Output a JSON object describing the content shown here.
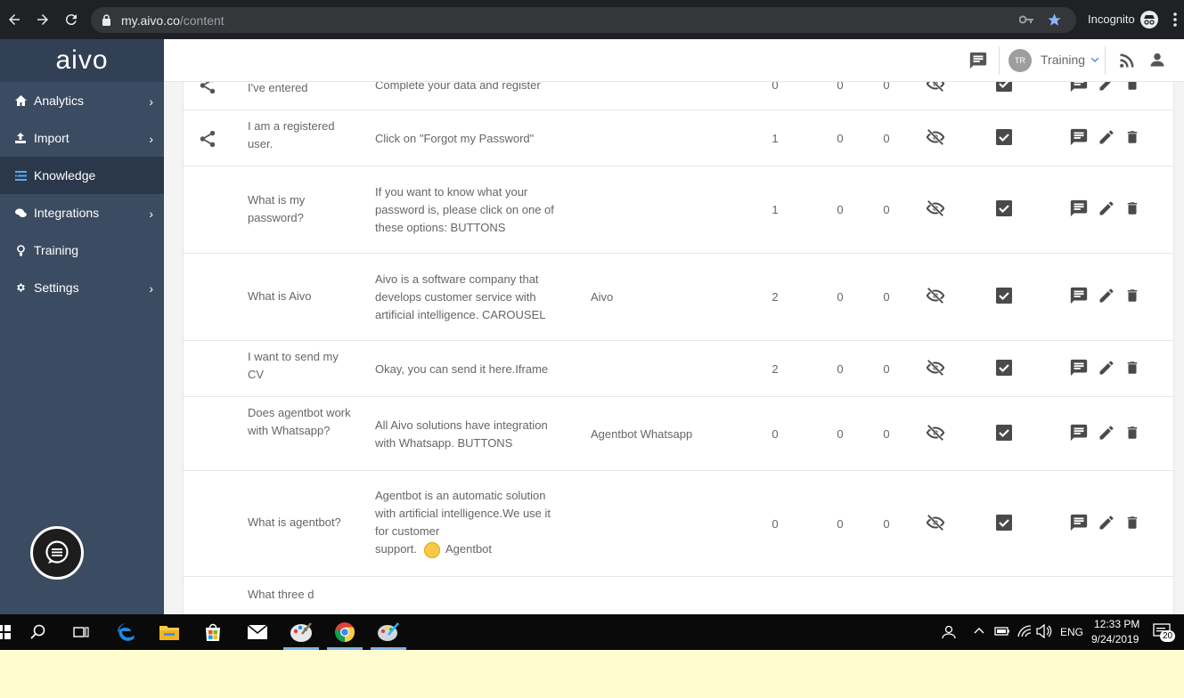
{
  "browser": {
    "url_domain": "my.aivo.co",
    "url_path": "/content",
    "incognito_label": "Incognito"
  },
  "sidebar": {
    "logo": "aivo",
    "items": [
      {
        "label": "Analytics",
        "icon": "home-icon",
        "has_submenu": true
      },
      {
        "label": "Import",
        "icon": "upload-icon",
        "has_submenu": true
      },
      {
        "label": "Knowledge",
        "icon": "list-icon",
        "has_submenu": false,
        "active": true
      },
      {
        "label": "Integrations",
        "icon": "chat-bubbles-icon",
        "has_submenu": true
      },
      {
        "label": "Training",
        "icon": "lightbulb-icon",
        "has_submenu": false
      },
      {
        "label": "Settings",
        "icon": "gear-icon",
        "has_submenu": true
      }
    ]
  },
  "header": {
    "avatar_initials": "TR",
    "training_label": "Training"
  },
  "rows": [
    {
      "share": true,
      "question": "It's the first time that I've entered",
      "answer": "Complete your data and register",
      "tag": "",
      "n1": "0",
      "n2": "0",
      "n3": "0"
    },
    {
      "share": true,
      "question": "I am a registered user.",
      "answer": "Click on \"Forgot my Password\"",
      "tag": "",
      "n1": "1",
      "n2": "0",
      "n3": "0"
    },
    {
      "share": false,
      "question": "What is my password?",
      "answer": "If you want to know what your password is, please click on one of these options: BUTTONS",
      "tag": "",
      "n1": "1",
      "n2": "0",
      "n3": "0"
    },
    {
      "share": false,
      "question": "What is Aivo",
      "answer": "Aivo is a software company that develops customer service with artificial intelligence. CAROUSEL",
      "tag": "Aivo",
      "n1": "2",
      "n2": "0",
      "n3": "0"
    },
    {
      "share": false,
      "question": "I want to send my CV",
      "answer": "Okay, you can send it here.Iframe",
      "tag": "",
      "n1": "2",
      "n2": "0",
      "n3": "0"
    },
    {
      "share": false,
      "question": "Does agentbot work with Whatsapp?",
      "answer": "All Aivo solutions have integration with Whatsapp. BUTTONS",
      "tag": "Agentbot Whatsapp",
      "n1": "0",
      "n2": "0",
      "n3": "0"
    },
    {
      "share": false,
      "question": "What is agentbot?",
      "answer": "Agentbot is an automatic solution with artificial intelligence.We use it for customer",
      "answer_tail_pre": "support.",
      "answer_tail_post": "Agentbot",
      "tag": "",
      "n1": "0",
      "n2": "0",
      "n3": "0"
    },
    {
      "share": false,
      "question": "What three d",
      "answer": "",
      "tag": "",
      "n1": "",
      "n2": "",
      "n3": ""
    }
  ],
  "taskbar": {
    "language": "ENG",
    "time": "12:33 PM",
    "date": "9/24/2019",
    "notifications": "20"
  },
  "colors": {
    "sidebar_bg": "#3b4b61",
    "sidebar_active": "#2b384b",
    "accent_blue": "#4a90d9",
    "icon_dark": "#4a4a4a"
  }
}
